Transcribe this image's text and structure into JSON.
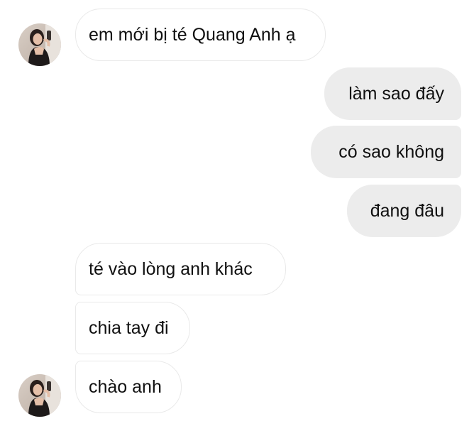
{
  "conversation": {
    "messages": [
      {
        "direction": "incoming",
        "text": "em mới bị té Quang Anh ạ"
      },
      {
        "direction": "outgoing",
        "text": "làm sao đấy"
      },
      {
        "direction": "outgoing",
        "text": "có sao không"
      },
      {
        "direction": "outgoing",
        "text": "đang đâu"
      },
      {
        "direction": "incoming",
        "text": "té vào lòng anh khác"
      },
      {
        "direction": "incoming",
        "text": "chia tay đi"
      },
      {
        "direction": "incoming",
        "text": "chào anh"
      }
    ]
  },
  "colors": {
    "incoming_bubble": "#ffffff",
    "incoming_border": "#e9e9e9",
    "outgoing_bubble": "#ececec",
    "text": "#101010"
  },
  "icons": {
    "avatar": "contact-photo"
  }
}
